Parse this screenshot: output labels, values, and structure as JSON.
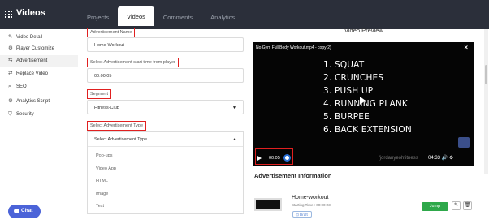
{
  "app": {
    "title": "Videos"
  },
  "tabs": [
    "Projects",
    "Videos",
    "Comments",
    "Analytics"
  ],
  "sidebar": {
    "items": [
      {
        "label": "Video Detail",
        "icon": "edit-icon"
      },
      {
        "label": "Player Customize",
        "icon": "gear-icon"
      },
      {
        "label": "Advertisement",
        "icon": "ad-icon"
      },
      {
        "label": "Replace Video",
        "icon": "replace-icon"
      },
      {
        "label": "SEO",
        "icon": "search-icon"
      },
      {
        "label": "Analytics Script",
        "icon": "code-icon"
      },
      {
        "label": "Security",
        "icon": "shield-icon"
      }
    ]
  },
  "form": {
    "ad_name_label": "Advertisement Name",
    "ad_name_value": "Home-Workout",
    "start_time_label": "Select Advertisement start time from player",
    "start_time_value": "00:00:05",
    "segment_label": "Segment",
    "segment_value": "Fitness-Club",
    "type_label": "Select Advertisement Type",
    "type_placeholder": "Select Advertisement Type",
    "type_options": [
      "Pop-ups",
      "Video App",
      "HTML",
      "Image",
      "Text"
    ]
  },
  "preview": {
    "title": "Video Preview",
    "video_title": "No Gym Full Body Workout.mp4 - copy(2)",
    "exercises": [
      "1. SQUAT",
      "2. CRUNCHES",
      "3. PUSH UP",
      "4. RUNNING PLANK",
      "5. BURPEE",
      "6. BACK EXTENSION"
    ],
    "watermark": "/jordanyeohfitness",
    "current_time": "00:05",
    "duration": "04:33"
  },
  "ad_info": {
    "title": "Advertisement Information",
    "name": "Home-workout",
    "start_time": "Starting Time : 00:00:23",
    "badge": "Draft",
    "jump_label": "Jump"
  },
  "chat": {
    "label": "Chat"
  },
  "colors": {
    "topbar": "#2b2f3a",
    "highlight": "#e02020",
    "jump": "#2ea84a",
    "chat": "#4b63d8"
  }
}
